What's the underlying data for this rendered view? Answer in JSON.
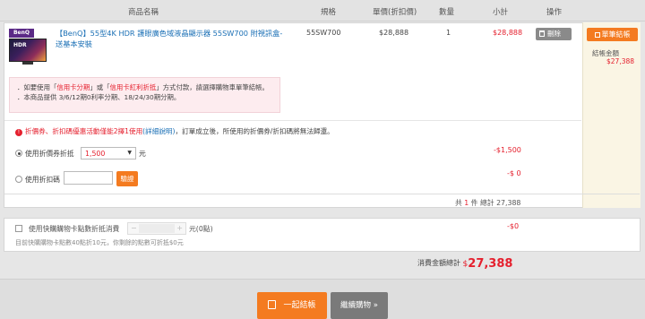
{
  "header": {
    "product_name": "商品名稱",
    "spec": "規格",
    "unit_price": "單價(折扣價)",
    "quantity": "數量",
    "subtotal": "小計",
    "action": "操作"
  },
  "item": {
    "logo_text": "BenQ",
    "screen_text": "HDR",
    "name": "【BenQ】55型4K HDR 護眼廣色域液晶顯示器 55SW700 附視訊盒-送基本安裝",
    "spec": "55SW700",
    "unit_price": "$28,888",
    "qty": "1",
    "subtotal": "$28,888",
    "delete_label": "刪除"
  },
  "side": {
    "checkout_label": "單筆結帳",
    "amount_label": "結帳金額",
    "amount": "$27,388"
  },
  "notice": {
    "line1_pre": "．如要使用「",
    "line1_a": "信用卡分期",
    "line1_mid": "」或「",
    "line1_b": "信用卡紅利折抵",
    "line1_post": "」方式付款，請選擇購物車單筆結帳。",
    "line2": "．本商品提供 3/6/12期0利率分期、18/24/30期分期。"
  },
  "discount": {
    "warning_red": "折價券、折扣碼優惠活動僅能2擇1使用",
    "warning_link": "(詳細說明)",
    "warning_rest": "，訂單成立後，所使用的折價券/折扣碼將無法歸還。",
    "coupon_label": "使用折價券折抵",
    "coupon_value": "1,500",
    "unit": "元",
    "coupon_amount": "-$1,500",
    "code_label": "使用折扣碼",
    "verify_button": "驗證",
    "code_amount": "-$ 0"
  },
  "summary": {
    "pre": "共",
    "count": "1",
    "mid": "件 總計",
    "total": "27,388"
  },
  "points": {
    "label": "使用快購購物卡點數折抵消費",
    "minus": "−",
    "plus": "+",
    "unit_text": "元(0點)",
    "amount": "-$0",
    "note": "目前快購購物卡點數40點折10元，你剩餘的點數可折抵$0元"
  },
  "grand": {
    "label": "消費金額總計",
    "currency": "$",
    "amount": "27,388"
  },
  "footer": {
    "checkout_all": "一起結帳",
    "continue": "繼續購物 »"
  }
}
